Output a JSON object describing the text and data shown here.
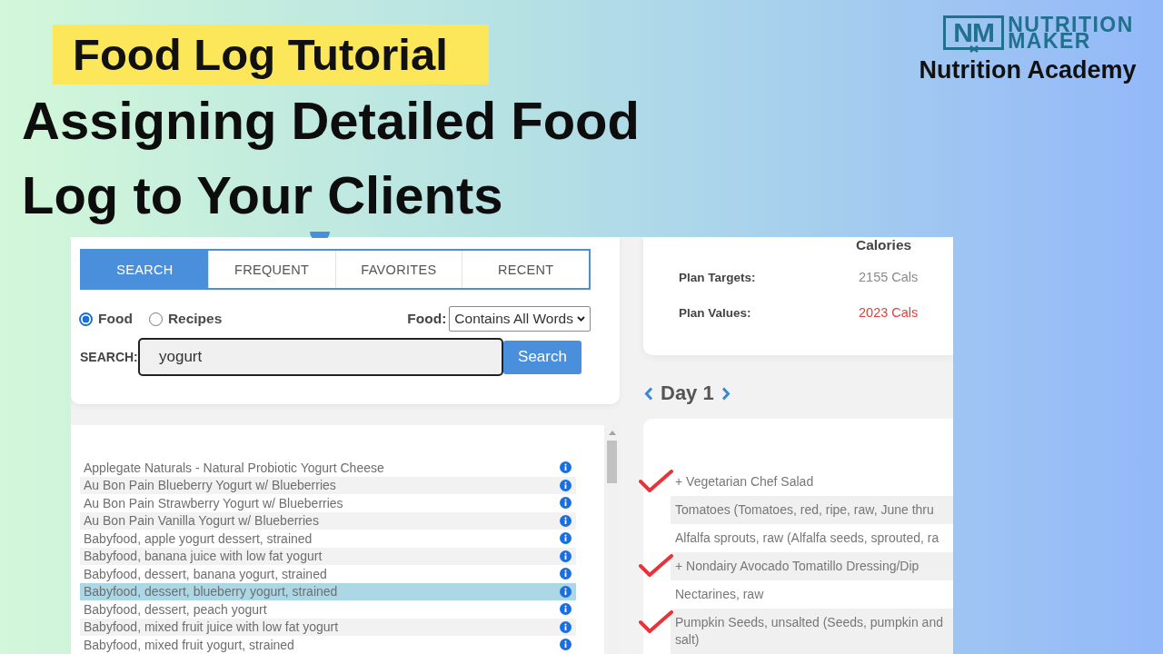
{
  "banner": {
    "label": "Food Log Tutorial"
  },
  "headline": "Assigning Detailed Food Log to Your Clients",
  "logo": {
    "mark": "NM",
    "wordmark": [
      "NUTRITION",
      "MAKER"
    ],
    "subtitle": "Nutrition Academy"
  },
  "search_panel": {
    "tabs": [
      {
        "label": "SEARCH",
        "selected": true
      },
      {
        "label": "FREQUENT",
        "selected": false
      },
      {
        "label": "FAVORITES",
        "selected": false
      },
      {
        "label": "RECENT",
        "selected": false
      }
    ],
    "source_options": [
      {
        "label": "Food",
        "selected": true
      },
      {
        "label": "Recipes",
        "selected": false
      }
    ],
    "match_label": "Food:",
    "match_value": "Contains All Words",
    "search_label": "SEARCH:",
    "search_value": "yogurt",
    "search_button": "Search"
  },
  "results": [
    {
      "name": "Applegate Naturals - Natural Probiotic Yogurt Cheese",
      "selected": false
    },
    {
      "name": "Au Bon Pain Blueberry Yogurt w/ Blueberries",
      "selected": false
    },
    {
      "name": "Au Bon Pain Strawberry Yogurt w/ Blueberries",
      "selected": false
    },
    {
      "name": "Au Bon Pain Vanilla Yogurt w/ Blueberries",
      "selected": false
    },
    {
      "name": "Babyfood, apple yogurt dessert, strained",
      "selected": false
    },
    {
      "name": "Babyfood, banana juice with low fat yogurt",
      "selected": false
    },
    {
      "name": "Babyfood, dessert, banana yogurt, strained",
      "selected": false
    },
    {
      "name": "Babyfood, dessert, blueberry yogurt, strained",
      "selected": true
    },
    {
      "name": "Babyfood, dessert, peach yogurt",
      "selected": false
    },
    {
      "name": "Babyfood, mixed fruit juice with low fat yogurt",
      "selected": false
    },
    {
      "name": "Babyfood, mixed fruit yogurt, strained",
      "selected": false
    }
  ],
  "plan_summary": {
    "column": "Calories",
    "rows": [
      {
        "label": "Plan Targets:",
        "value": "2155 Cals",
        "color": "#8a8a8a"
      },
      {
        "label": "Plan Values:",
        "value": "2023 Cals",
        "color": "#e0403f"
      }
    ]
  },
  "day_nav": {
    "label": "Day 1"
  },
  "meal_items": [
    {
      "lines": [
        "+ Vegetarian Chef Salad"
      ],
      "checked": true
    },
    {
      "lines": [
        "Tomatoes (Tomatoes, red, ripe, raw, June thru"
      ],
      "checked": false
    },
    {
      "lines": [
        "Alfalfa sprouts, raw (Alfalfa seeds, sprouted, ra"
      ],
      "checked": false
    },
    {
      "lines": [
        "+ Nondairy Avocado Tomatillo Dressing/Dip"
      ],
      "checked": true
    },
    {
      "lines": [
        "Nectarines, raw"
      ],
      "checked": false
    },
    {
      "lines": [
        "Pumpkin Seeds, unsalted (Seeds, pumpkin and",
        "salt)"
      ],
      "checked": true
    }
  ]
}
